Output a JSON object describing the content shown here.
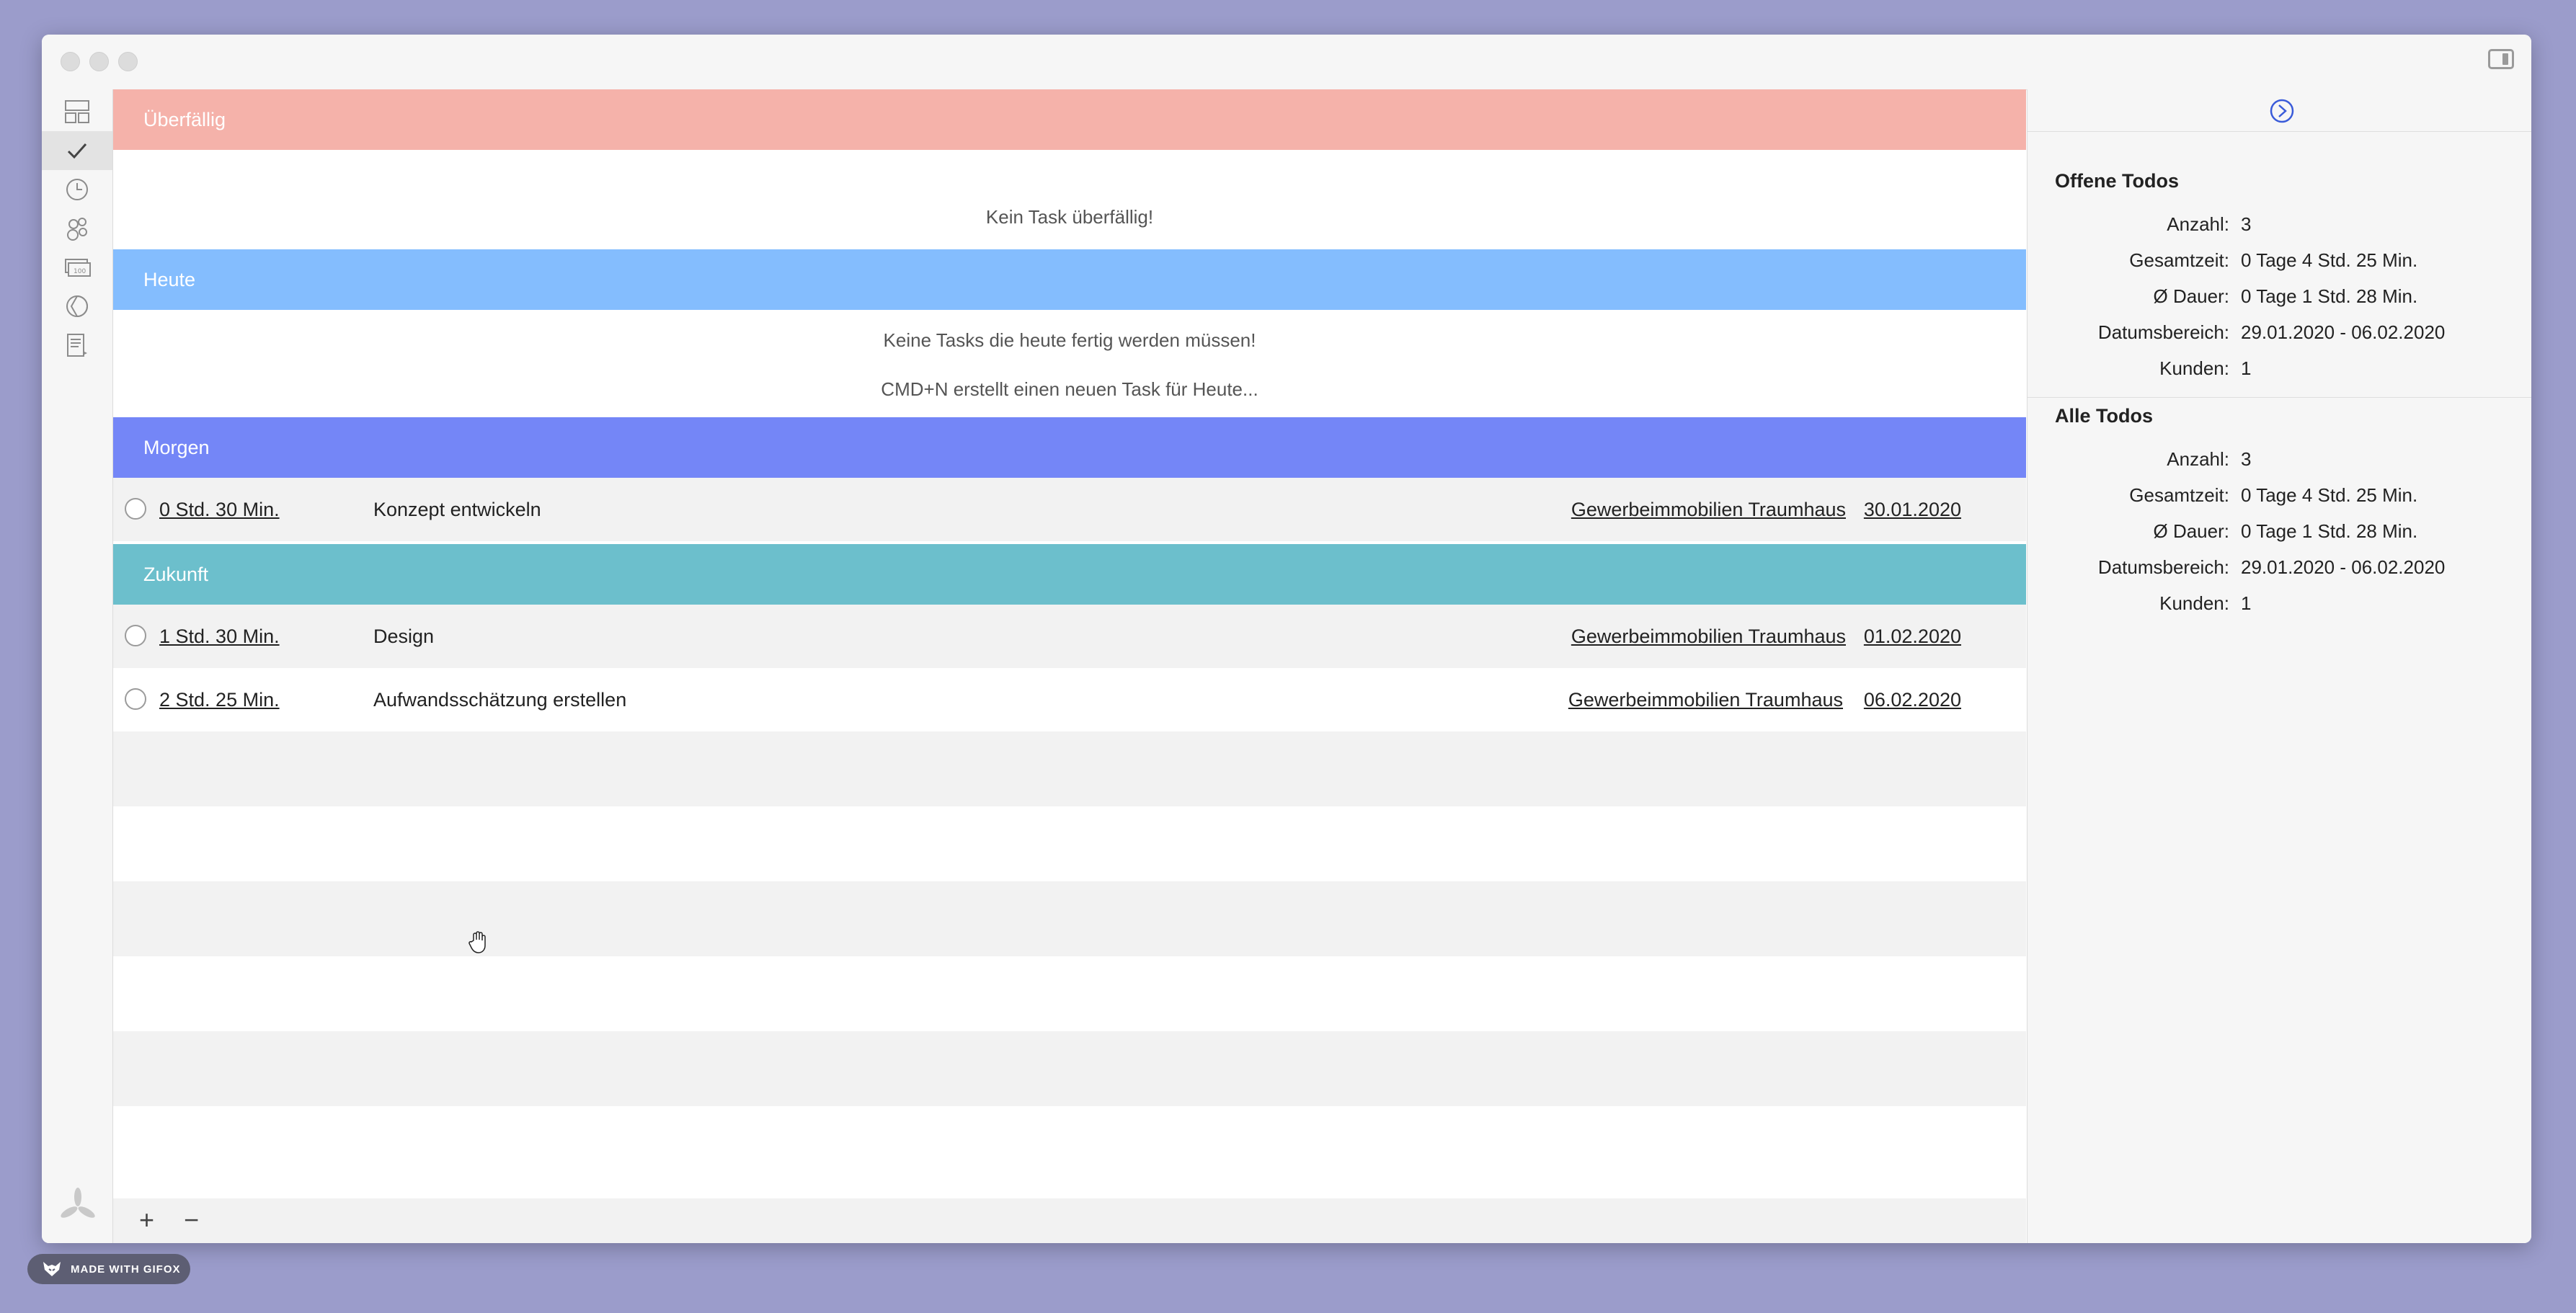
{
  "sections": {
    "overdue": {
      "label": "Überfällig",
      "color": "#f5b2aa",
      "empty_text": "Kein Task überfällig!"
    },
    "today": {
      "label": "Heute",
      "color": "#84bdfe",
      "empty_text": "Keine Tasks die heute fertig werden müssen!",
      "hint_text": "CMD+N erstellt einen neuen Task für Heute..."
    },
    "tomorrow": {
      "label": "Morgen",
      "color": "#7486f7"
    },
    "future": {
      "label": "Zukunft",
      "color": "#6cbfcc"
    }
  },
  "tasks": [
    {
      "duration": "0 Std. 30 Min.",
      "title": "Konzept entwickeln",
      "client": "Gewerbeimmobilien Traumhaus",
      "date": "30.01.2020"
    },
    {
      "duration": "1 Std. 30 Min.",
      "title": "Design",
      "client": "Gewerbeimmobilien Traumhaus",
      "date": "01.02.2020"
    },
    {
      "duration": "2 Std. 25 Min.",
      "title": "Aufwandsschätzung erstellen",
      "client": "Gewerbeimmobilien Traumhaus",
      "date": "06.02.2020"
    }
  ],
  "bottombar": {
    "add_label": "+",
    "remove_label": "−"
  },
  "stats": {
    "open": {
      "title": "Offene Todos",
      "rows": [
        {
          "label": "Anzahl:",
          "value": "3"
        },
        {
          "label": "Gesamtzeit:",
          "value": "0 Tage 4 Std. 25 Min."
        },
        {
          "label": "Ø Dauer:",
          "value": "0 Tage 1 Std. 28 Min."
        },
        {
          "label": "Datumsbereich:",
          "value": "29.01.2020 - 06.02.2020"
        },
        {
          "label": "Kunden:",
          "value": "1"
        }
      ]
    },
    "all": {
      "title": "Alle Todos",
      "rows": [
        {
          "label": "Anzahl:",
          "value": "3"
        },
        {
          "label": "Gesamtzeit:",
          "value": "0 Tage 4 Std. 25 Min."
        },
        {
          "label": "Ø Dauer:",
          "value": "0 Tage 1 Std. 28 Min."
        },
        {
          "label": "Datumsbereich:",
          "value": "29.01.2020 - 06.02.2020"
        },
        {
          "label": "Kunden:",
          "value": "1"
        }
      ]
    }
  },
  "watermark": {
    "text": "MADE WITH GIFOX"
  }
}
